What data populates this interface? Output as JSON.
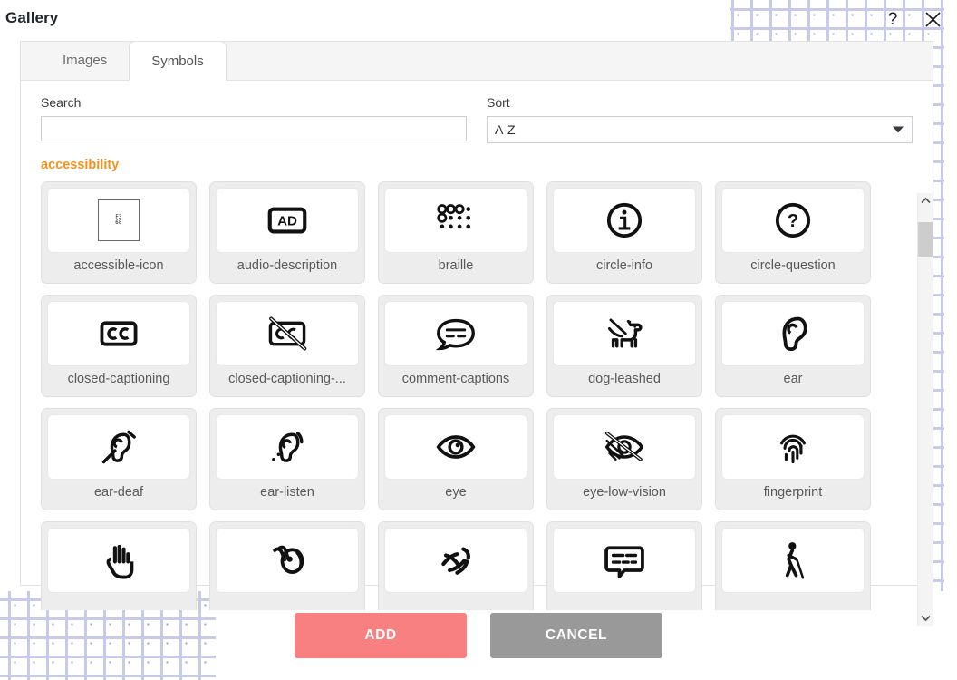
{
  "window": {
    "title": "Gallery",
    "help_icon": "question-mark-icon",
    "close_icon": "close-x-icon"
  },
  "tabs": [
    {
      "label": "Images",
      "active": false
    },
    {
      "label": "Symbols",
      "active": true
    }
  ],
  "search": {
    "label": "Search",
    "value": "",
    "placeholder": ""
  },
  "sort": {
    "label": "Sort",
    "value": "A-Z",
    "options": [
      "A-Z"
    ]
  },
  "category": {
    "name": "accessibility",
    "color": "#f0921e"
  },
  "symbols": [
    {
      "label": "accessible-icon",
      "icon": "tofu-missing-glyph-f368",
      "codepoint": "F368"
    },
    {
      "label": "audio-description",
      "icon": "audio-description-icon"
    },
    {
      "label": "braille",
      "icon": "braille-icon"
    },
    {
      "label": "circle-info",
      "icon": "circle-info-icon"
    },
    {
      "label": "circle-question",
      "icon": "circle-question-icon"
    },
    {
      "label": "closed-captioning",
      "icon": "closed-captioning-icon"
    },
    {
      "label": "closed-captioning-...",
      "icon": "closed-captioning-slash-icon"
    },
    {
      "label": "comment-captions",
      "icon": "comment-captions-icon"
    },
    {
      "label": "dog-leashed",
      "icon": "dog-leashed-icon"
    },
    {
      "label": "ear",
      "icon": "ear-icon"
    },
    {
      "label": "ear-deaf",
      "icon": "ear-deaf-icon"
    },
    {
      "label": "ear-listen",
      "icon": "ear-listen-icon"
    },
    {
      "label": "eye",
      "icon": "eye-icon"
    },
    {
      "label": "eye-low-vision",
      "icon": "eye-low-vision-icon"
    },
    {
      "label": "fingerprint",
      "icon": "fingerprint-icon"
    },
    {
      "label": "",
      "icon": "hands-asl-interpreting-icon"
    },
    {
      "label": "",
      "icon": "hands-holding-sign-icon"
    },
    {
      "label": "",
      "icon": "hand-point-sign-icon"
    },
    {
      "label": "",
      "icon": "message-captions-icon"
    },
    {
      "label": "",
      "icon": "person-walking-with-cane-icon"
    }
  ],
  "scrollbar": {
    "up_icon": "chevron-up-icon",
    "down_icon": "chevron-down-icon"
  },
  "footer": {
    "add_label": "ADD",
    "cancel_label": "CANCEL",
    "add_color": "#f98080",
    "cancel_color": "#999999"
  }
}
